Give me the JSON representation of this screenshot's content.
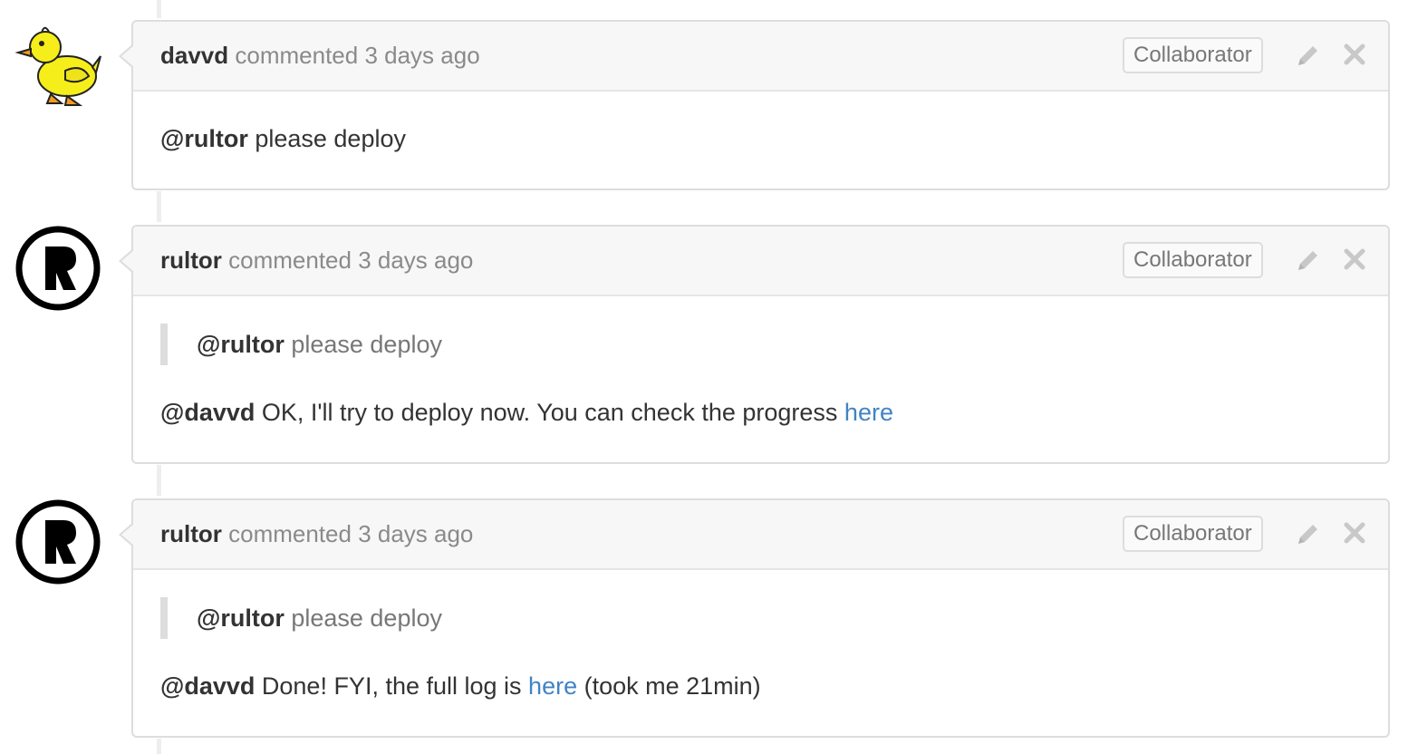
{
  "comments": [
    {
      "author": "davvd",
      "action": "commented 3 days ago",
      "badge": "Collaborator",
      "avatar_icon": "duck-avatar",
      "quote_mention": "",
      "quote_text": "",
      "mention": "@rultor",
      "text": "please deploy",
      "link_text": "",
      "text_after": ""
    },
    {
      "author": "rultor",
      "action": "commented 3 days ago",
      "badge": "Collaborator",
      "avatar_icon": "rultor-r-avatar",
      "quote_mention": "@rultor",
      "quote_text": "please deploy",
      "mention": "@davvd",
      "text": "OK, I'll try to deploy now. You can check the progress",
      "link_text": "here",
      "text_after": ""
    },
    {
      "author": "rultor",
      "action": "commented 3 days ago",
      "badge": "Collaborator",
      "avatar_icon": "rultor-r-avatar",
      "quote_mention": "@rultor",
      "quote_text": "please deploy",
      "mention": "@davvd",
      "text": "Done! FYI, the full log is",
      "link_text": "here",
      "text_after": "(took me 21min)"
    }
  ],
  "icons": {
    "edit": "pencil-icon",
    "delete": "close-icon"
  },
  "colors": {
    "link": "#4183c4",
    "header_bg": "#f7f7f7",
    "border": "#dddddd"
  }
}
